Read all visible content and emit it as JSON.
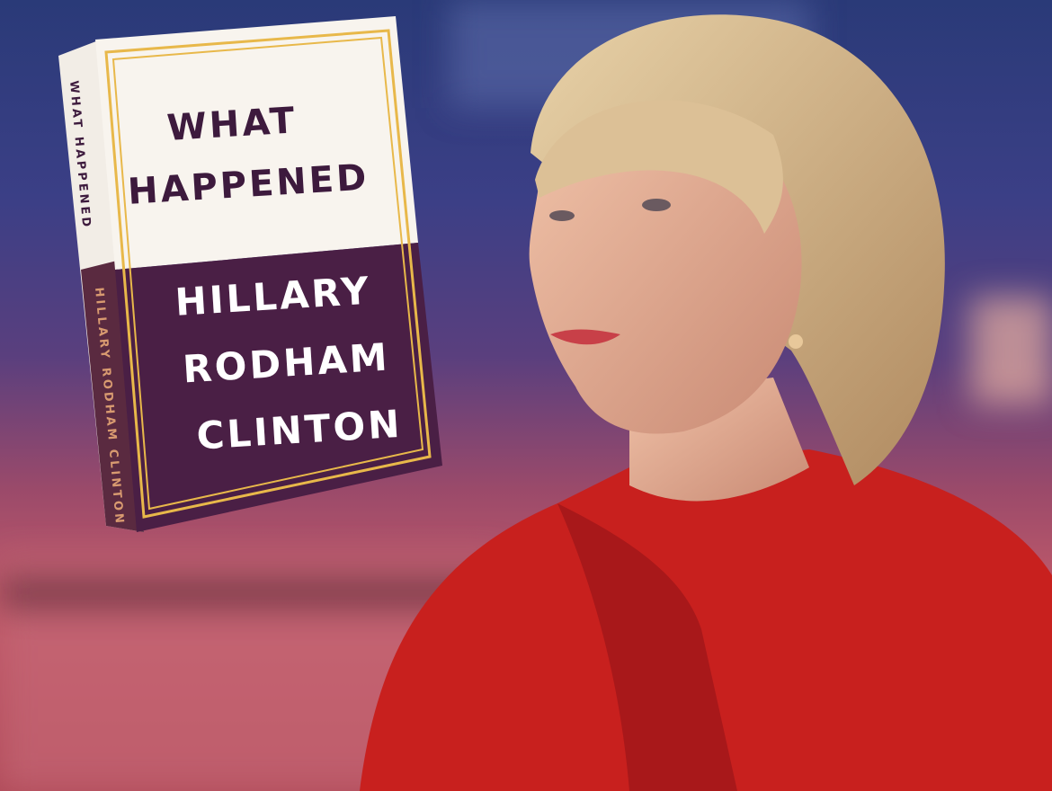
{
  "book": {
    "title_line1": "WHAT",
    "title_line2": "HAPPENED",
    "author_line1": "HILLARY",
    "author_line2": "RODHAM",
    "author_line3": "CLINTON",
    "spine_title": "WHAT HAPPENED",
    "spine_author": "HILLARY RODHAM CLINTON",
    "colors": {
      "cover_top": "#f5f0ea",
      "cover_bottom": "#4a1f45",
      "border": "#e8b84a",
      "title": "#3d1a3d"
    }
  }
}
